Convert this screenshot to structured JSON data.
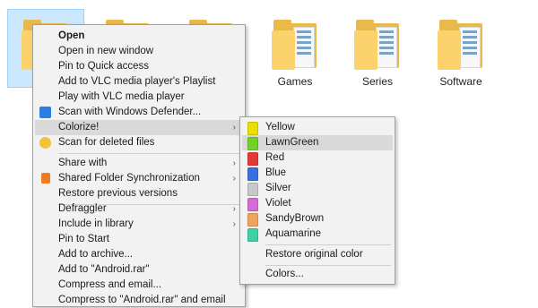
{
  "folders": [
    {
      "label": ""
    },
    {
      "label": ""
    },
    {
      "label": ""
    },
    {
      "label": "Games"
    },
    {
      "label": "Series"
    },
    {
      "label": "Software"
    }
  ],
  "context_menu": {
    "items": [
      {
        "label": "Open",
        "icon": ""
      },
      {
        "label": "Open in new window",
        "icon": ""
      },
      {
        "label": "Pin to Quick access",
        "icon": ""
      },
      {
        "label": "Add to VLC media player's Playlist",
        "icon": ""
      },
      {
        "label": "Play with VLC media player",
        "icon": ""
      },
      {
        "label": "Scan with Windows Defender...",
        "icon": "windows-defender-icon"
      },
      {
        "label": "Colorize!",
        "icon": ""
      },
      {
        "label": "Scan for deleted files",
        "icon": "recovery-scan-icon"
      },
      {
        "label": "Share with",
        "icon": ""
      },
      {
        "label": "Shared Folder Synchronization",
        "icon": "sync-icon"
      },
      {
        "label": "Restore previous versions",
        "icon": ""
      },
      {
        "label": "Defraggler",
        "icon": ""
      },
      {
        "label": "Include in library",
        "icon": ""
      },
      {
        "label": "Pin to Start",
        "icon": ""
      },
      {
        "label": "Add to archive...",
        "icon": ""
      },
      {
        "label": "Add to \"Android.rar\"",
        "icon": ""
      },
      {
        "label": "Compress and email...",
        "icon": ""
      },
      {
        "label": "Compress to \"Android.rar\" and email",
        "icon": ""
      }
    ],
    "submenu_arrow": "›"
  },
  "colorize_menu": {
    "colors": [
      {
        "label": "Yellow",
        "color": "#e8e000"
      },
      {
        "label": "LawnGreen",
        "color": "#6fd12a"
      },
      {
        "label": "Red",
        "color": "#e53935"
      },
      {
        "label": "Blue",
        "color": "#3b6fe0"
      },
      {
        "label": "Silver",
        "color": "#c8c8c8"
      },
      {
        "label": "Violet",
        "color": "#d66bd6"
      },
      {
        "label": "SandyBrown",
        "color": "#f0a35a"
      },
      {
        "label": "Aquamarine",
        "color": "#3fd1a5"
      }
    ],
    "restore_label": "Restore original color",
    "colors_label": "Colors..."
  }
}
